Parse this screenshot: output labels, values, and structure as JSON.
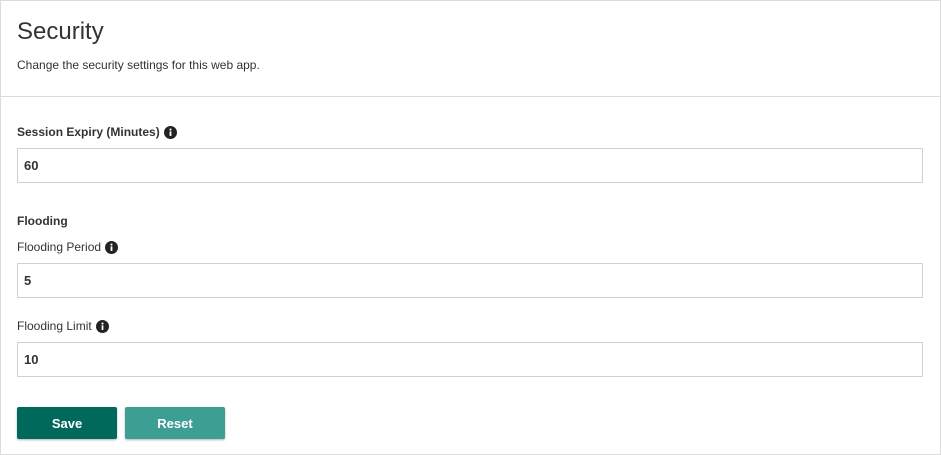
{
  "header": {
    "title": "Security",
    "subtitle": "Change the security settings for this web app."
  },
  "session": {
    "label": "Session Expiry (Minutes)",
    "value": "60"
  },
  "flooding": {
    "section_title": "Flooding",
    "period_label": "Flooding Period",
    "period_value": "5",
    "limit_label": "Flooding Limit",
    "limit_value": "10"
  },
  "actions": {
    "save_label": "Save",
    "reset_label": "Reset"
  },
  "icons": {
    "info": "info-icon"
  },
  "colors": {
    "primary": "#00695c",
    "secondary": "#3d9e94",
    "border": "#dcdcdc"
  }
}
